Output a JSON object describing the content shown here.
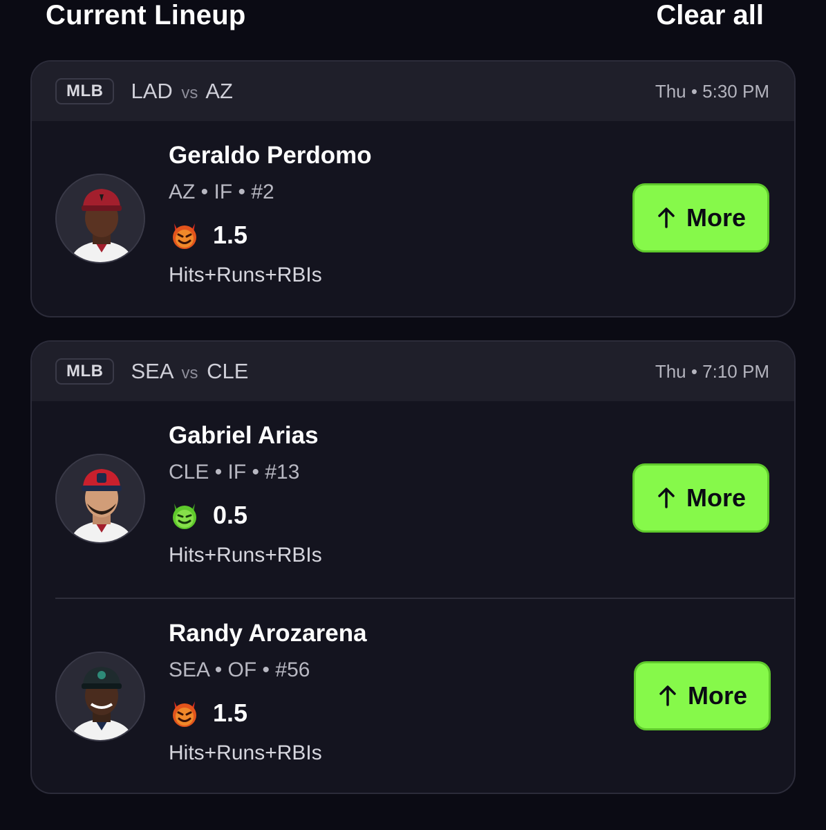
{
  "header": {
    "title": "Current Lineup",
    "clear_label": "Clear all"
  },
  "colors": {
    "accent": "#86f94a",
    "background": "#0b0b14",
    "card": "#14141f"
  },
  "games": [
    {
      "league": "MLB",
      "home": "LAD",
      "vs": "vs",
      "away": "AZ",
      "time": "Thu • 5:30 PM",
      "picks": [
        {
          "name": "Geraldo Perdomo",
          "meta": "AZ • IF • #2",
          "line": "1.5",
          "stat": "Hits+Runs+RBIs",
          "icon": "orange-devil-icon",
          "button": "More",
          "button_icon": "arrow-up-icon"
        }
      ]
    },
    {
      "league": "MLB",
      "home": "SEA",
      "vs": "vs",
      "away": "CLE",
      "time": "Thu • 7:10 PM",
      "picks": [
        {
          "name": "Gabriel Arias",
          "meta": "CLE • IF • #13",
          "line": "0.5",
          "stat": "Hits+Runs+RBIs",
          "icon": "green-devil-icon",
          "button": "More",
          "button_icon": "arrow-up-icon"
        },
        {
          "name": "Randy Arozarena",
          "meta": "SEA • OF • #56",
          "line": "1.5",
          "stat": "Hits+Runs+RBIs",
          "icon": "orange-devil-icon",
          "button": "More",
          "button_icon": "arrow-up-icon"
        }
      ]
    }
  ]
}
